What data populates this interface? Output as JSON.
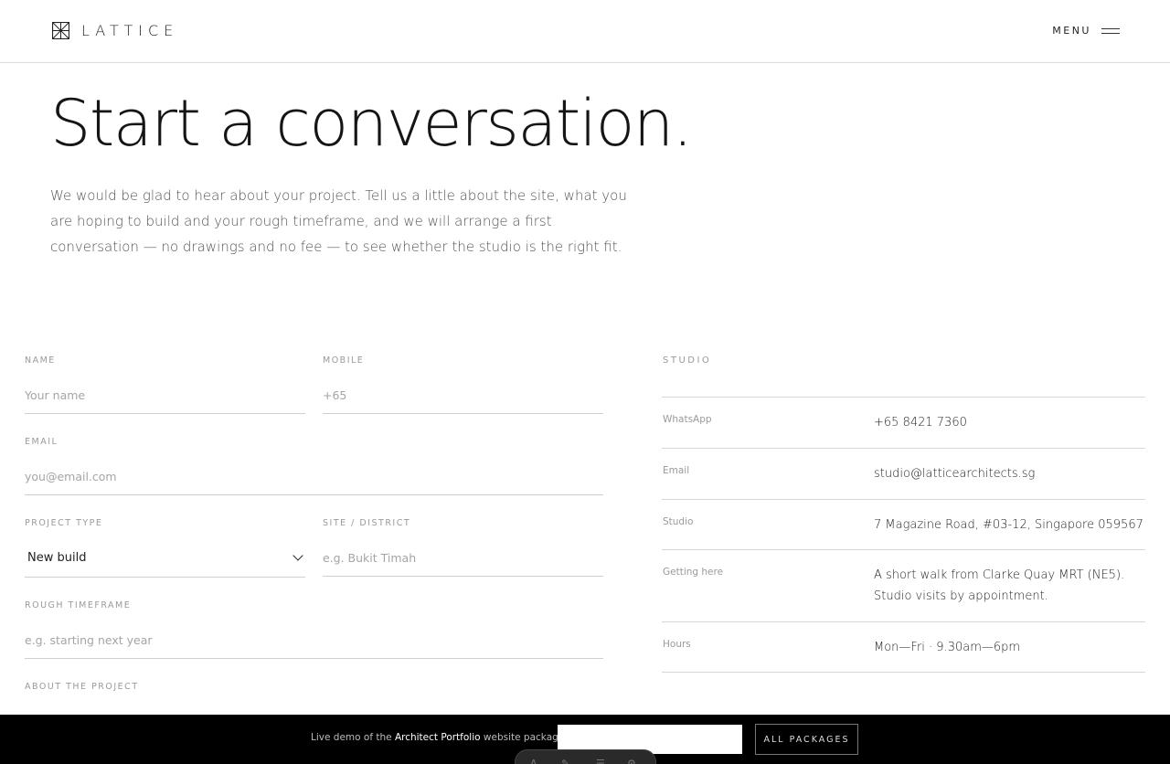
{
  "header": {
    "brand": "LATTICE",
    "menu_label": "MENU"
  },
  "hero": {
    "title": "Start a conversation.",
    "intro": "We would be glad to hear about your project. Tell us a little about the site, what you are hoping to build and your rough timeframe, and we will arrange a first conversation — no drawings and no fee — to see whether the studio is the right fit."
  },
  "form": {
    "name": {
      "label": "NAME",
      "placeholder": "Your name"
    },
    "mobile": {
      "label": "MOBILE",
      "placeholder": "+65"
    },
    "email": {
      "label": "EMAIL",
      "placeholder": "you@email.com"
    },
    "project_type": {
      "label": "PROJECT TYPE",
      "value": "New build"
    },
    "site": {
      "label": "SITE / DISTRICT",
      "placeholder": "e.g. Bukit Timah"
    },
    "timeframe": {
      "label": "ROUGH TIMEFRAME",
      "placeholder": "e.g. starting next year"
    },
    "about": {
      "label": "ABOUT THE PROJECT"
    }
  },
  "studio": {
    "heading": "STUDIO",
    "rows": [
      {
        "key": "WhatsApp",
        "value": "+65 8421 7360"
      },
      {
        "key": "Email",
        "value": "studio@latticearchitects.sg"
      },
      {
        "key": "Studio",
        "value": "7 Magazine Road, #03-12, Singapore 059567"
      },
      {
        "key": "Getting here",
        "value": "A short walk from Clarke Quay MRT (NE5). Studio visits by appointment."
      },
      {
        "key": "Hours",
        "value": "Mon—Fri · 9.30am—6pm"
      }
    ]
  },
  "demo_bar": {
    "prefix": "Live demo of the",
    "product": "Architect Portfolio",
    "suffix": "website package.",
    "button": "ALL PACKAGES"
  }
}
